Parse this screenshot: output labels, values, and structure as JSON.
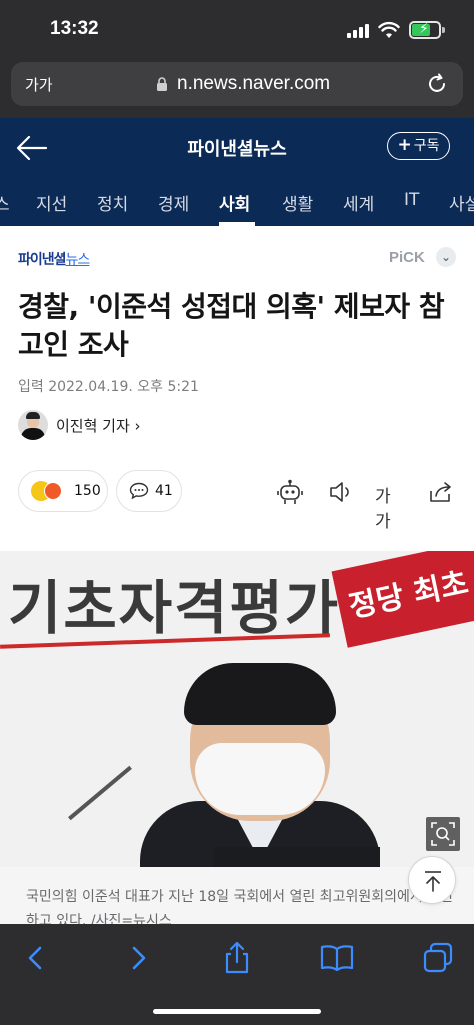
{
  "status_bar": {
    "time": "13:32",
    "battery_level": 0.7
  },
  "safari": {
    "text_size_label": "가가",
    "url": "n.news.naver.com"
  },
  "press_header": {
    "title": "파이낸셜뉴스",
    "subscribe_label": "구독"
  },
  "categories": [
    {
      "label": "스"
    },
    {
      "label": "지선"
    },
    {
      "label": "정치"
    },
    {
      "label": "경제"
    },
    {
      "label": "사회",
      "active": true
    },
    {
      "label": "생활"
    },
    {
      "label": "세계"
    },
    {
      "label": "IT"
    },
    {
      "label": "사설"
    }
  ],
  "article": {
    "brand_part1": "파이낸셜",
    "brand_part2": "뉴스",
    "pick_label": "PiCK",
    "headline": "경찰, '이준석 성접대 의혹' 제보자 참고인 조사",
    "date": "입력 2022.04.19. 오후 5:21",
    "reporter": "이진혁 기자",
    "reaction_count": "150",
    "comment_count": "41",
    "font_tool_label": "가가",
    "photo": {
      "banner_text": "기초자격평가",
      "tag_text": "정당 최초"
    },
    "caption": "국민의힘 이준석 대표가 지난 18일 국회에서 열린 최고위원회의에서 발언하고 있다. /사진=뉴시스"
  },
  "colors": {
    "header_bg": "#0b2a56",
    "safari_chrome": "#2d2d2f",
    "safari_accent": "#3b8cff",
    "brand_blue": "#1a3c8f"
  }
}
